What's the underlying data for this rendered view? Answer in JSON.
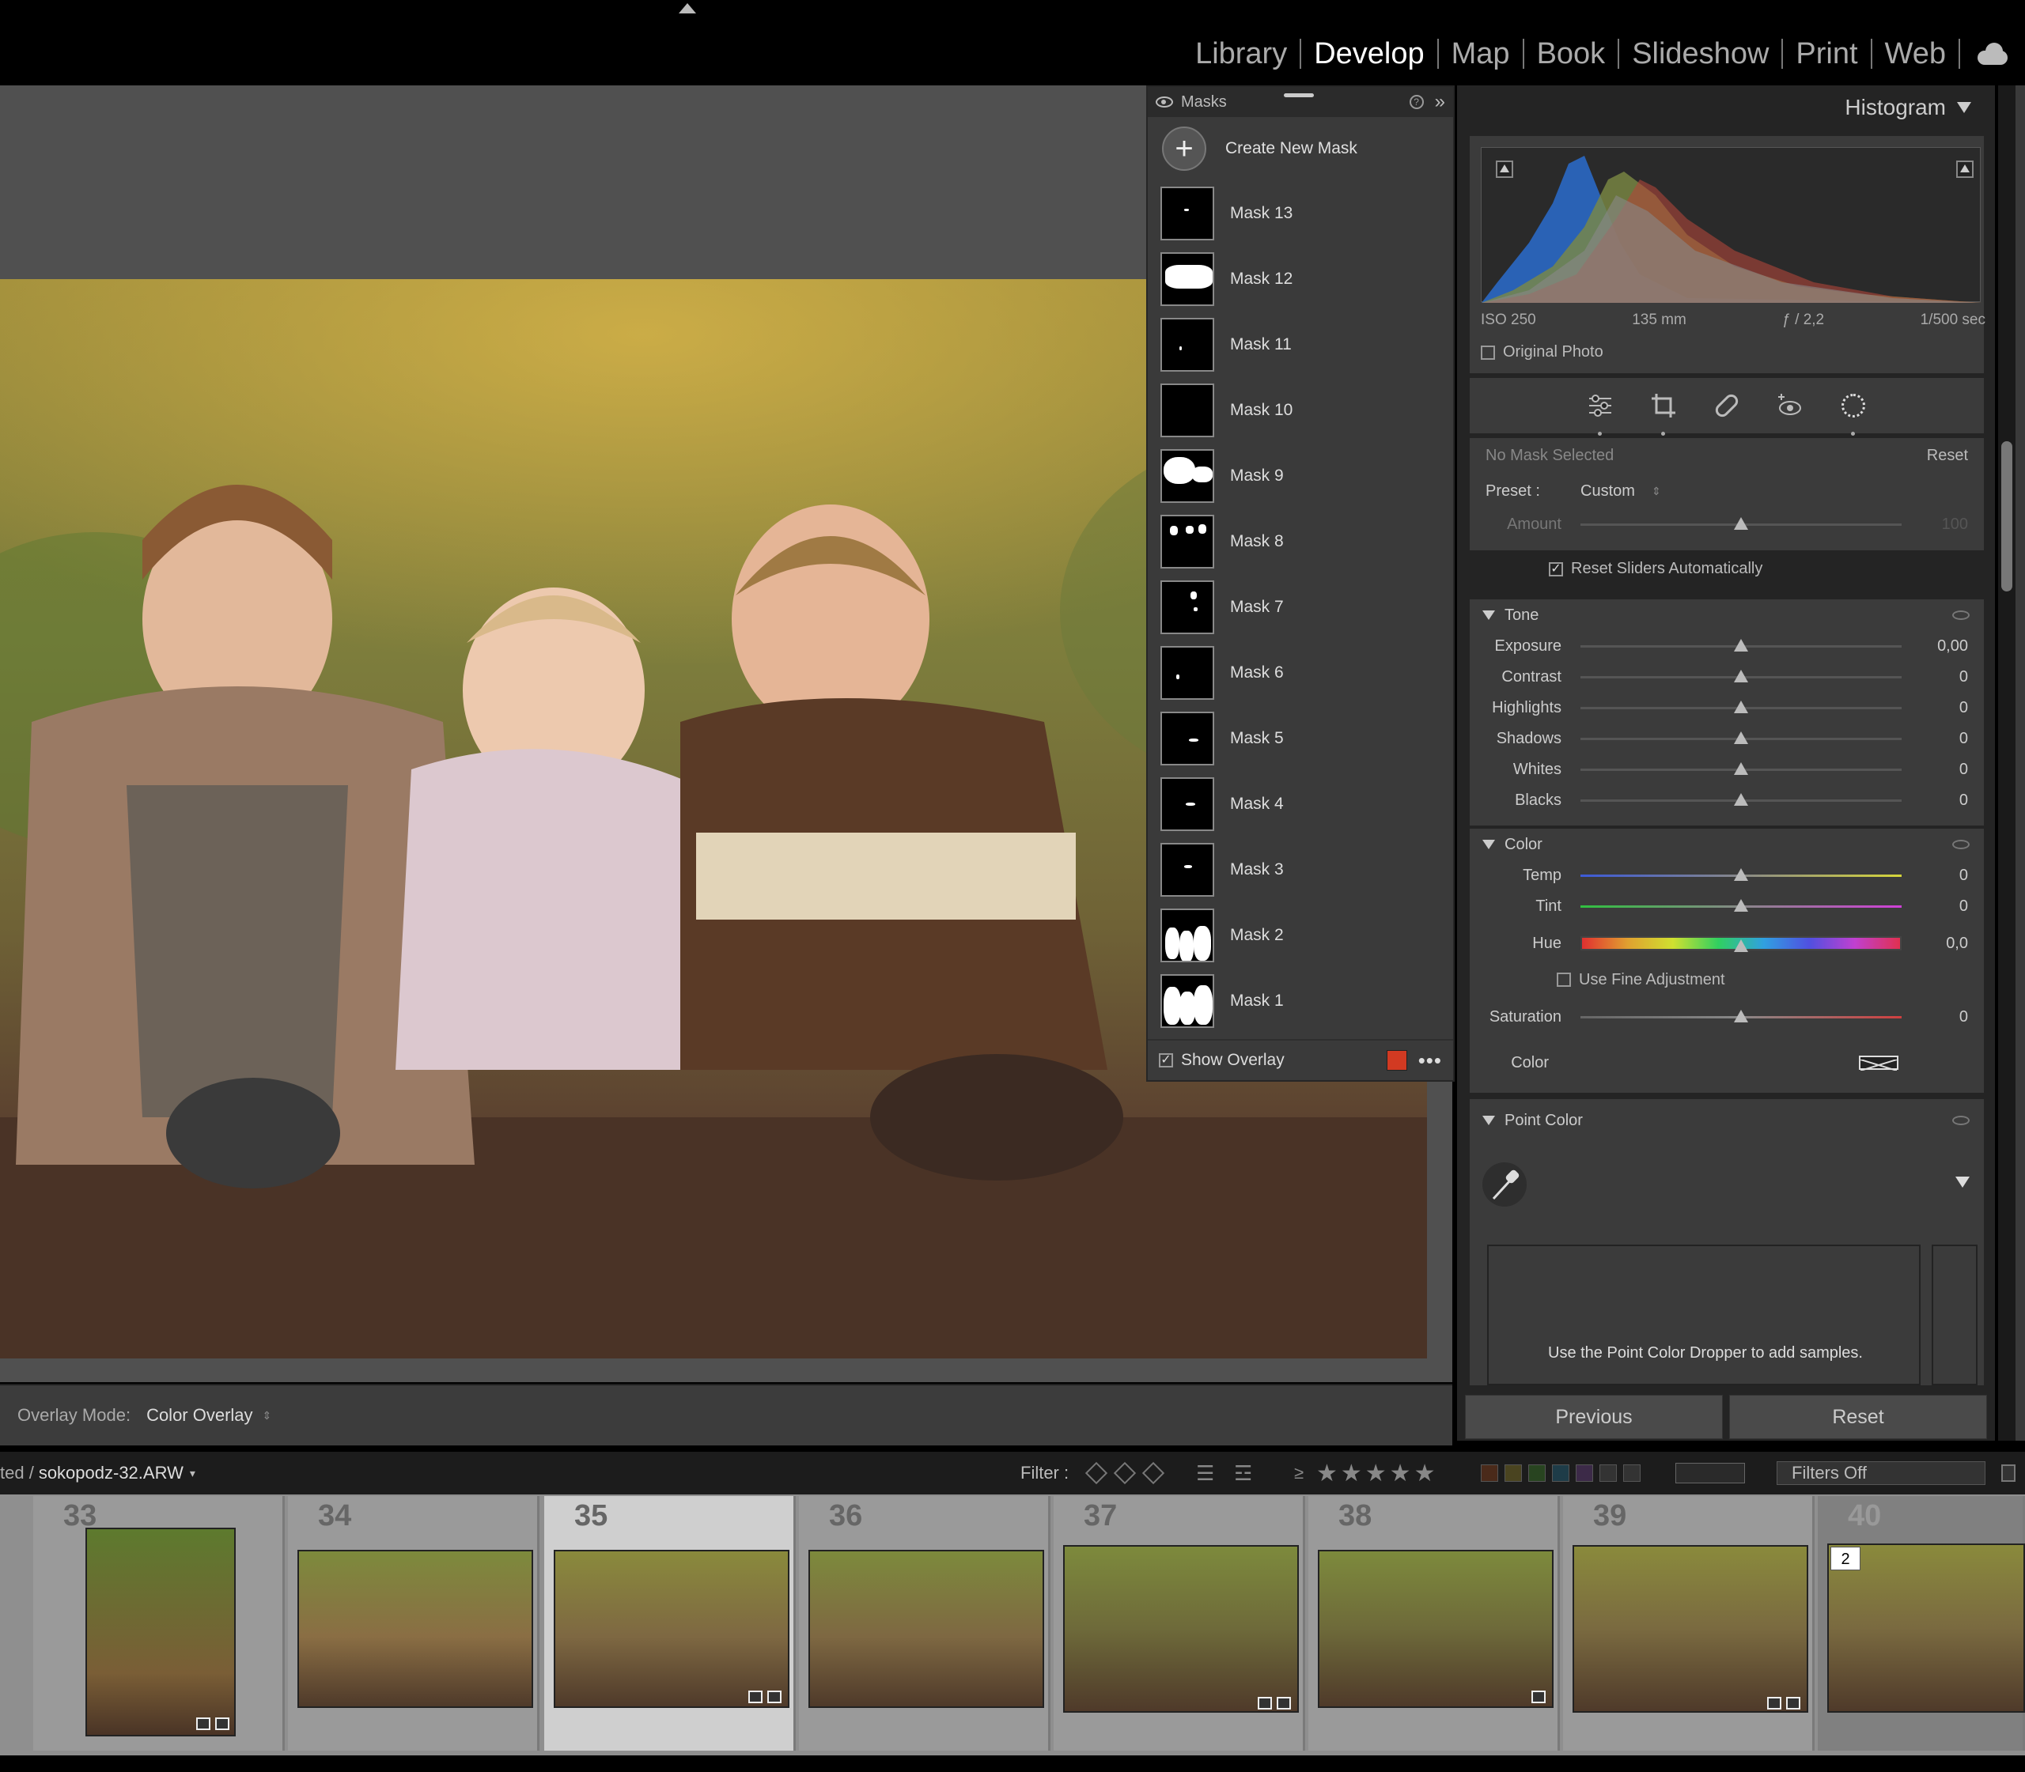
{
  "modules": [
    {
      "label": "Library",
      "active": false
    },
    {
      "label": "Develop",
      "active": true
    },
    {
      "label": "Map",
      "active": false
    },
    {
      "label": "Book",
      "active": false
    },
    {
      "label": "Slideshow",
      "active": false
    },
    {
      "label": "Print",
      "active": false
    },
    {
      "label": "Web",
      "active": false
    }
  ],
  "masks_panel": {
    "title": "Masks",
    "create_label": "Create New Mask",
    "items": [
      "Mask 13",
      "Mask 12",
      "Mask 11",
      "Mask 10",
      "Mask 9",
      "Mask 8",
      "Mask 7",
      "Mask 6",
      "Mask 5",
      "Mask 4",
      "Mask 3",
      "Mask 2",
      "Mask 1"
    ],
    "show_overlay_label": "Show Overlay",
    "show_overlay_checked": true,
    "overlay_color": "#d23a22"
  },
  "toolbar": {
    "overlay_mode_label": "Overlay Mode:",
    "overlay_mode_value": "Color Overlay"
  },
  "histogram": {
    "title": "Histogram",
    "iso": "ISO 250",
    "focal": "135 mm",
    "aperture": "ƒ / 2,2",
    "shutter": "1/500 sec",
    "original_photo_label": "Original Photo"
  },
  "mask_settings": {
    "status": "No Mask Selected",
    "reset_label": "Reset",
    "preset_label": "Preset :",
    "preset_value": "Custom",
    "amount_label": "Amount",
    "amount_value": "100",
    "reset_sliders_label": "Reset Sliders Automatically"
  },
  "tone": {
    "title": "Tone",
    "sliders": [
      {
        "label": "Exposure",
        "value": "0,00"
      },
      {
        "label": "Contrast",
        "value": "0"
      },
      {
        "label": "Highlights",
        "value": "0"
      },
      {
        "label": "Shadows",
        "value": "0"
      },
      {
        "label": "Whites",
        "value": "0"
      },
      {
        "label": "Blacks",
        "value": "0"
      }
    ]
  },
  "color": {
    "title": "Color",
    "temp_label": "Temp",
    "temp_value": "0",
    "tint_label": "Tint",
    "tint_value": "0",
    "hue_label": "Hue",
    "hue_value": "0,0",
    "fine_adjust_label": "Use Fine Adjustment",
    "saturation_label": "Saturation",
    "saturation_value": "0",
    "color_label": "Color"
  },
  "point_color": {
    "title": "Point Color",
    "hint": "Use the Point Color Dropper to add samples."
  },
  "buttons": {
    "previous": "Previous",
    "reset": "Reset"
  },
  "filmstrip_bar": {
    "path_prefix": "ted /",
    "filename": "sokopodz-32.ARW",
    "filter_label": "Filter :",
    "rating_op": "≥",
    "stars": "★★★★★",
    "filters_off": "Filters Off"
  },
  "filmstrip": {
    "numbers": [
      "33",
      "34",
      "35",
      "36",
      "37",
      "38",
      "39",
      "40"
    ],
    "selected": "35",
    "stack_count": "2"
  }
}
